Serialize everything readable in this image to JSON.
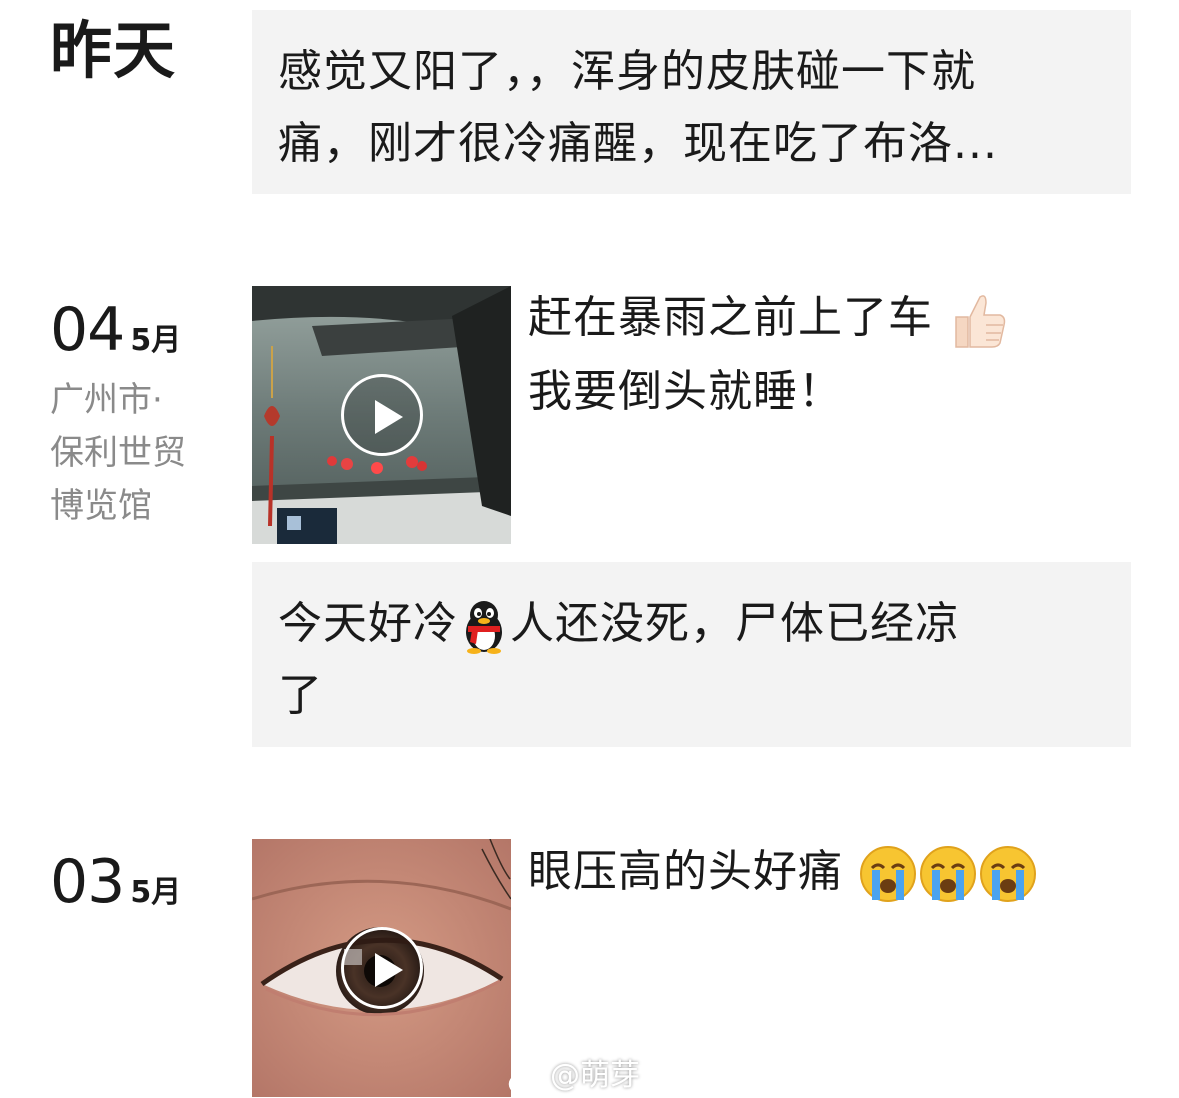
{
  "entries": [
    {
      "date_label": "昨天",
      "text_line1": "感觉又阳了，，浑身的皮肤碰一下就",
      "text_line2": "痛，刚才很冷痛醒，现在吃了布洛..."
    },
    {
      "day": "04",
      "month": "5月",
      "location": [
        "广州市·",
        "保利世贸",
        "博览馆"
      ],
      "video_post": {
        "line1": "赶在暴雨之前上了车",
        "line1_emoji": "thumbs-up",
        "line2": "我要倒头就睡！"
      },
      "text_post": {
        "part1": "今天好冷",
        "emoji": "qq-penguin-cold",
        "part2": "人还没死，尸体已经凉",
        "line2": "了"
      }
    },
    {
      "day": "03",
      "month": "5月",
      "video_post": {
        "line1": "眼压高的头好痛",
        "emojis": [
          "crying-face",
          "crying-face",
          "crying-face"
        ]
      }
    }
  ],
  "watermark": "@萌芽"
}
